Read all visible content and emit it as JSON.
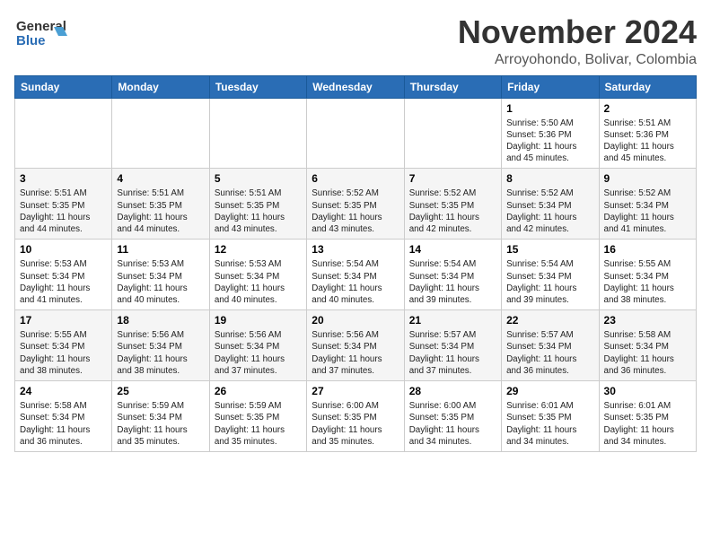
{
  "header": {
    "logo_line1": "General",
    "logo_line2": "Blue",
    "month": "November 2024",
    "location": "Arroyohondo, Bolivar, Colombia"
  },
  "weekdays": [
    "Sunday",
    "Monday",
    "Tuesday",
    "Wednesday",
    "Thursday",
    "Friday",
    "Saturday"
  ],
  "weeks": [
    [
      {
        "day": "",
        "info": ""
      },
      {
        "day": "",
        "info": ""
      },
      {
        "day": "",
        "info": ""
      },
      {
        "day": "",
        "info": ""
      },
      {
        "day": "",
        "info": ""
      },
      {
        "day": "1",
        "info": "Sunrise: 5:50 AM\nSunset: 5:36 PM\nDaylight: 11 hours\nand 45 minutes."
      },
      {
        "day": "2",
        "info": "Sunrise: 5:51 AM\nSunset: 5:36 PM\nDaylight: 11 hours\nand 45 minutes."
      }
    ],
    [
      {
        "day": "3",
        "info": "Sunrise: 5:51 AM\nSunset: 5:35 PM\nDaylight: 11 hours\nand 44 minutes."
      },
      {
        "day": "4",
        "info": "Sunrise: 5:51 AM\nSunset: 5:35 PM\nDaylight: 11 hours\nand 44 minutes."
      },
      {
        "day": "5",
        "info": "Sunrise: 5:51 AM\nSunset: 5:35 PM\nDaylight: 11 hours\nand 43 minutes."
      },
      {
        "day": "6",
        "info": "Sunrise: 5:52 AM\nSunset: 5:35 PM\nDaylight: 11 hours\nand 43 minutes."
      },
      {
        "day": "7",
        "info": "Sunrise: 5:52 AM\nSunset: 5:35 PM\nDaylight: 11 hours\nand 42 minutes."
      },
      {
        "day": "8",
        "info": "Sunrise: 5:52 AM\nSunset: 5:34 PM\nDaylight: 11 hours\nand 42 minutes."
      },
      {
        "day": "9",
        "info": "Sunrise: 5:52 AM\nSunset: 5:34 PM\nDaylight: 11 hours\nand 41 minutes."
      }
    ],
    [
      {
        "day": "10",
        "info": "Sunrise: 5:53 AM\nSunset: 5:34 PM\nDaylight: 11 hours\nand 41 minutes."
      },
      {
        "day": "11",
        "info": "Sunrise: 5:53 AM\nSunset: 5:34 PM\nDaylight: 11 hours\nand 40 minutes."
      },
      {
        "day": "12",
        "info": "Sunrise: 5:53 AM\nSunset: 5:34 PM\nDaylight: 11 hours\nand 40 minutes."
      },
      {
        "day": "13",
        "info": "Sunrise: 5:54 AM\nSunset: 5:34 PM\nDaylight: 11 hours\nand 40 minutes."
      },
      {
        "day": "14",
        "info": "Sunrise: 5:54 AM\nSunset: 5:34 PM\nDaylight: 11 hours\nand 39 minutes."
      },
      {
        "day": "15",
        "info": "Sunrise: 5:54 AM\nSunset: 5:34 PM\nDaylight: 11 hours\nand 39 minutes."
      },
      {
        "day": "16",
        "info": "Sunrise: 5:55 AM\nSunset: 5:34 PM\nDaylight: 11 hours\nand 38 minutes."
      }
    ],
    [
      {
        "day": "17",
        "info": "Sunrise: 5:55 AM\nSunset: 5:34 PM\nDaylight: 11 hours\nand 38 minutes."
      },
      {
        "day": "18",
        "info": "Sunrise: 5:56 AM\nSunset: 5:34 PM\nDaylight: 11 hours\nand 38 minutes."
      },
      {
        "day": "19",
        "info": "Sunrise: 5:56 AM\nSunset: 5:34 PM\nDaylight: 11 hours\nand 37 minutes."
      },
      {
        "day": "20",
        "info": "Sunrise: 5:56 AM\nSunset: 5:34 PM\nDaylight: 11 hours\nand 37 minutes."
      },
      {
        "day": "21",
        "info": "Sunrise: 5:57 AM\nSunset: 5:34 PM\nDaylight: 11 hours\nand 37 minutes."
      },
      {
        "day": "22",
        "info": "Sunrise: 5:57 AM\nSunset: 5:34 PM\nDaylight: 11 hours\nand 36 minutes."
      },
      {
        "day": "23",
        "info": "Sunrise: 5:58 AM\nSunset: 5:34 PM\nDaylight: 11 hours\nand 36 minutes."
      }
    ],
    [
      {
        "day": "24",
        "info": "Sunrise: 5:58 AM\nSunset: 5:34 PM\nDaylight: 11 hours\nand 36 minutes."
      },
      {
        "day": "25",
        "info": "Sunrise: 5:59 AM\nSunset: 5:34 PM\nDaylight: 11 hours\nand 35 minutes."
      },
      {
        "day": "26",
        "info": "Sunrise: 5:59 AM\nSunset: 5:35 PM\nDaylight: 11 hours\nand 35 minutes."
      },
      {
        "day": "27",
        "info": "Sunrise: 6:00 AM\nSunset: 5:35 PM\nDaylight: 11 hours\nand 35 minutes."
      },
      {
        "day": "28",
        "info": "Sunrise: 6:00 AM\nSunset: 5:35 PM\nDaylight: 11 hours\nand 34 minutes."
      },
      {
        "day": "29",
        "info": "Sunrise: 6:01 AM\nSunset: 5:35 PM\nDaylight: 11 hours\nand 34 minutes."
      },
      {
        "day": "30",
        "info": "Sunrise: 6:01 AM\nSunset: 5:35 PM\nDaylight: 11 hours\nand 34 minutes."
      }
    ]
  ]
}
